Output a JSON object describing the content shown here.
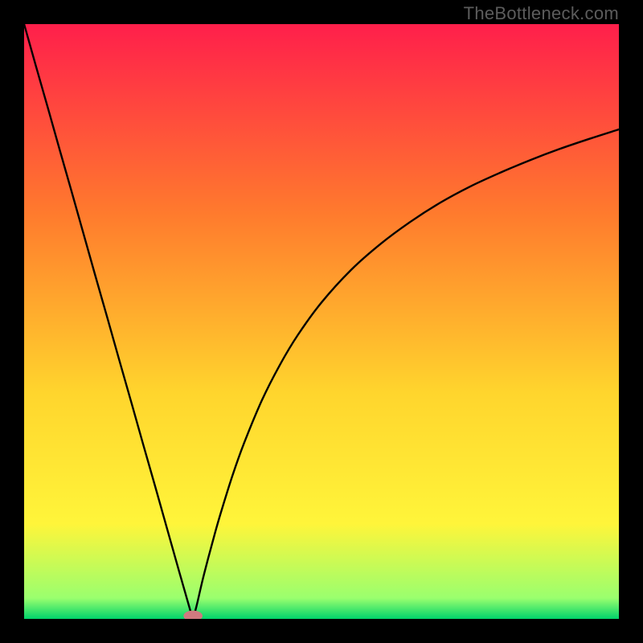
{
  "watermark": "TheBottleneck.com",
  "chart_data": {
    "type": "line",
    "title": "",
    "xlabel": "",
    "ylabel": "",
    "xlim": [
      0,
      100
    ],
    "ylim": [
      0,
      100
    ],
    "grid": false,
    "background_gradient": [
      "#ff1f4b",
      "#ff7b2d",
      "#ffd52d",
      "#fff53a",
      "#9aff6e",
      "#00d36b"
    ],
    "marker": {
      "x": 28.4,
      "y": 0.5,
      "color": "#cf7a7f",
      "rx": 1.6,
      "ry": 0.9
    },
    "series": [
      {
        "name": "left-branch",
        "x": [
          0,
          2,
          4,
          6,
          8,
          10,
          12,
          14,
          16,
          18,
          20,
          22,
          24,
          26,
          27,
          28,
          28.4
        ],
        "y": [
          100,
          92.9,
          85.9,
          78.8,
          71.8,
          64.7,
          57.6,
          50.6,
          43.5,
          36.5,
          29.4,
          22.4,
          15.3,
          8.2,
          4.7,
          1.2,
          0.0
        ]
      },
      {
        "name": "right-branch",
        "x": [
          28.4,
          29,
          30,
          31,
          32,
          33,
          35,
          37,
          40,
          43,
          46,
          50,
          55,
          60,
          65,
          70,
          75,
          80,
          85,
          90,
          95,
          100
        ],
        "y": [
          0.0,
          2.2,
          6.5,
          10.4,
          14.1,
          17.6,
          24.0,
          29.6,
          36.8,
          42.7,
          47.7,
          53.2,
          58.7,
          63.1,
          66.8,
          70.0,
          72.7,
          75.0,
          77.1,
          79.0,
          80.7,
          82.3
        ]
      }
    ]
  }
}
